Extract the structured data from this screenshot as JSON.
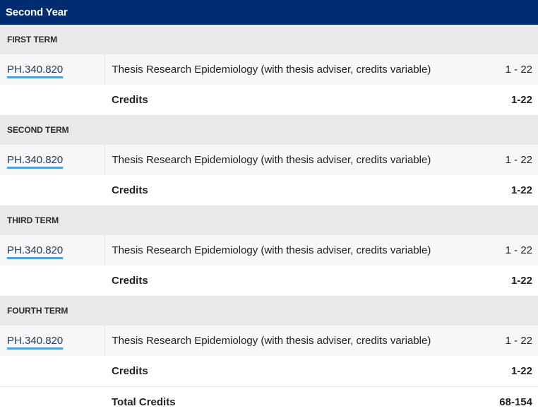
{
  "year": "Second Year",
  "terms": [
    {
      "name": "FIRST TERM",
      "course": {
        "code": "PH.340.820",
        "title": "Thesis Research Epidemiology (with thesis adviser, credits variable)",
        "hours": "1 - 22"
      },
      "credits_label": "Credits",
      "credits_value": "1-22"
    },
    {
      "name": "SECOND TERM",
      "course": {
        "code": "PH.340.820",
        "title": "Thesis Research Epidemiology (with thesis adviser, credits variable)",
        "hours": "1 - 22"
      },
      "credits_label": "Credits",
      "credits_value": "1-22"
    },
    {
      "name": "THIRD TERM",
      "course": {
        "code": "PH.340.820",
        "title": "Thesis Research Epidemiology (with thesis adviser, credits variable)",
        "hours": "1 - 22"
      },
      "credits_label": "Credits",
      "credits_value": "1-22"
    },
    {
      "name": "FOURTH TERM",
      "course": {
        "code": "PH.340.820",
        "title": "Thesis Research Epidemiology (with thesis adviser, credits variable)",
        "hours": "1 - 22"
      },
      "credits_label": "Credits",
      "credits_value": "1-22"
    }
  ],
  "total": {
    "label": "Total Credits",
    "value": "68-154"
  },
  "colors": {
    "header_bg": "#002d72",
    "term_bg": "#e9e9e9",
    "link_underline": "#4aa3df"
  }
}
